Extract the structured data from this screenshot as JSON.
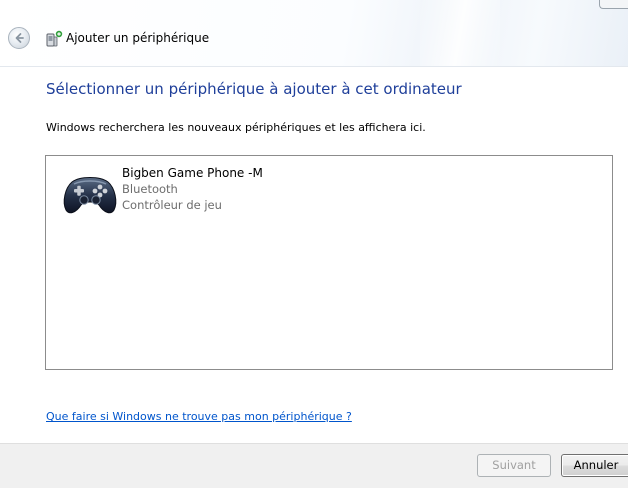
{
  "window": {
    "title": "Ajouter un périphérique"
  },
  "main": {
    "heading": "Sélectionner un périphérique à ajouter à cet ordinateur",
    "instruction": "Windows recherchera les nouveaux périphériques et les affichera ici.",
    "devices": [
      {
        "name": "Bigben Game Phone -M",
        "connection": "Bluetooth",
        "category": "Contrôleur de jeu",
        "icon": "gamepad-icon"
      }
    ],
    "help_link": "Que faire si Windows ne trouve pas mon périphérique ?"
  },
  "buttons": {
    "next_label": "Suivant",
    "cancel_label": "Annuler"
  },
  "colors": {
    "heading": "#1f3f9a",
    "link": "#0055cc",
    "secondary_text": "#6d6d6d"
  }
}
